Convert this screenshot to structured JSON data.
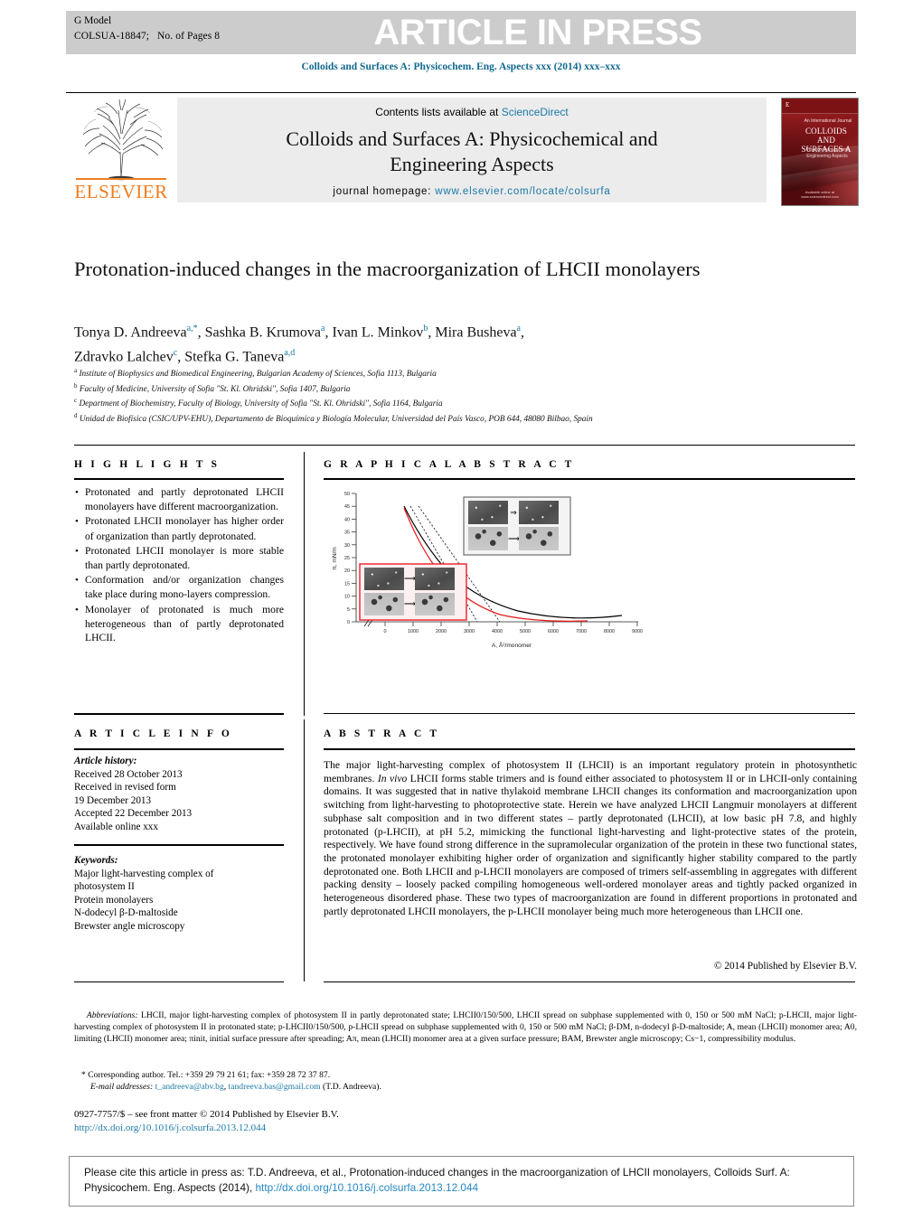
{
  "header": {
    "g_model": "G Model",
    "article_id": "COLSUA-18847;",
    "pages": "No. of Pages 8",
    "in_press": "ARTICLE IN PRESS",
    "journal_ref": "Colloids and Surfaces A: Physicochem. Eng. Aspects xxx (2014) xxx–xxx"
  },
  "masthead": {
    "contents_prefix": "Contents lists available at ",
    "sciencedirect": "ScienceDirect",
    "journal_title_line1": "Colloids and Surfaces A: Physicochemical and",
    "journal_title_line2": "Engineering Aspects",
    "homepage_label": "journal homepage: ",
    "homepage_url": "www.elsevier.com/locate/colsurfa",
    "publisher": "ELSEVIER"
  },
  "cover": {
    "top_small": "An International Journal",
    "title": "COLLOIDS AND SURFACES A",
    "subtitle": "Physicochemical and Engineering Aspects",
    "footer": "Available online at www.sciencedirect.com",
    "elsevier_mark": "E"
  },
  "article": {
    "title": "Protonation-induced changes in the macroorganization of LHCII monolayers",
    "authors_line1": "Tonya D. Andreeva",
    "authors_line1_sup": "a,*",
    "authors": [
      {
        "name": "Tonya D. Andreeva",
        "sup": "a,*"
      },
      {
        "name": "Sashka B. Krumova",
        "sup": "a"
      },
      {
        "name": "Ivan L. Minkov",
        "sup": "b"
      },
      {
        "name": "Mira Busheva",
        "sup": "a"
      },
      {
        "name": "Zdravko Lalchev",
        "sup": "c"
      },
      {
        "name": "Stefka G. Taneva",
        "sup": "a,d"
      }
    ],
    "affiliations": [
      {
        "mark": "a",
        "text": "Institute of Biophysics and Biomedical Engineering, Bulgarian Academy of Sciences, Sofia 1113, Bulgaria"
      },
      {
        "mark": "b",
        "text": "Faculty of Medicine, University of Sofia \"St. Kl. Ohridski\", Sofia 1407, Bulgaria"
      },
      {
        "mark": "c",
        "text": "Department of Biochemistry, Faculty of Biology, University of Sofia \"St. Kl. Ohridski\", Sofia 1164, Bulgaria"
      },
      {
        "mark": "d",
        "text": "Unidad de Biofísica (CSIC/UPV-EHU), Departamento de Bioquímica y Biología Molecular, Universidad del País Vasco, POB 644, 48080 Bilbao, Spain"
      }
    ]
  },
  "highlights": {
    "heading": "H I G H L I G H T S",
    "items": [
      "Protonated and partly deprotonated LHCII monolayers have different macroorganization.",
      "Protonated LHCII monolayer has higher order of organization than partly deprotonated.",
      "Protonated LHCII monolayer is more stable than partly deprotonated.",
      "Conformation and/or organization changes take place during mono-layers compression.",
      "Monolayer of protonated is much more heterogeneous than of partly deprotonated LHCII."
    ]
  },
  "graphical_abstract": {
    "heading": "G R A P H I C A L   A B S T R A C T"
  },
  "chart_data": {
    "type": "line",
    "title": "",
    "xlabel": "A, Å²/monomer",
    "ylabel": "π, mN/m",
    "xlim": [
      0,
      9000
    ],
    "ylim": [
      0,
      50
    ],
    "xticks": [
      0,
      1000,
      2000,
      3000,
      4000,
      5000,
      6000,
      7000,
      8000,
      9000
    ],
    "yticks": [
      0,
      5,
      10,
      15,
      20,
      25,
      30,
      35,
      40,
      45,
      50
    ],
    "grid": false,
    "legend": "none",
    "axis_break_x": true,
    "series": [
      {
        "name": "p-LHCII (black isotherm)",
        "color": "#000000",
        "style": "solid",
        "x": [
          700,
          900,
          1200,
          1600,
          2000,
          2600,
          3200,
          4000,
          4800,
          5600,
          6400,
          7200,
          8000,
          8400
        ],
        "y": [
          45.0,
          40.5,
          34.0,
          27.0,
          22.5,
          17.5,
          14.0,
          10.2,
          7.4,
          5.4,
          4.0,
          3.2,
          2.6,
          2.3
        ]
      },
      {
        "name": "LHCII (red isotherm)",
        "color": "#e8191b",
        "style": "solid",
        "x": [
          700,
          900,
          1200,
          1600,
          2000,
          2600,
          3200,
          4000,
          4800,
          5600,
          6400,
          7200,
          7900
        ],
        "y": [
          44.5,
          39.0,
          31.5,
          23.5,
          18.0,
          12.5,
          8.8,
          5.3,
          3.1,
          1.9,
          1.2,
          0.8,
          0.5
        ]
      },
      {
        "name": "extrapolation line 1 (dashed black)",
        "color": "#000000",
        "style": "dashed",
        "x": [
          900,
          3300
        ],
        "y": [
          45.0,
          0.0
        ]
      },
      {
        "name": "extrapolation line 2 (dashed black)",
        "color": "#000000",
        "style": "dashed",
        "x": [
          1200,
          4100
        ],
        "y": [
          45.0,
          0.0
        ]
      }
    ],
    "insets": [
      {
        "name": "p-LHCII inset (grey border)",
        "border_color": "#6f6f6f",
        "panels": [
          "BAM image",
          "arrow",
          "BAM image",
          "AFM image",
          "arrow",
          "AFM image"
        ]
      },
      {
        "name": "LHCII inset (red border)",
        "border_color": "#ee1c25",
        "panels": [
          "BAM image",
          "arrow",
          "BAM image",
          "AFM image",
          "arrow",
          "AFM image"
        ]
      }
    ]
  },
  "article_info": {
    "heading": "A R T I C L E   I N F O",
    "history_label": "Article history:",
    "history": [
      "Received 28 October 2013",
      "Received in revised form",
      "19 December 2013",
      "Accepted 22 December 2013",
      "Available online xxx"
    ],
    "keywords_label": "Keywords:",
    "keywords": [
      "Major light-harvesting complex of",
      "photosystem II",
      "Protein monolayers",
      "N-dodecyl β-D-maltoside",
      "Brewster angle microscopy"
    ]
  },
  "abstract": {
    "heading": "A B S T R A C T",
    "body_part1": "The major light-harvesting complex of photosystem II (LHCII) is an important regulatory protein in photosynthetic membranes. ",
    "body_italic1": "In vivo",
    "body_part2": " LHCII forms stable trimers and is found either associated to photosystem II or in LHCII-only containing domains. It was suggested that in native thylakoid membrane LHCII changes its conformation and macroorganization upon switching from light-harvesting to photoprotective state. Herein we have analyzed LHCII Langmuir monolayers at different subphase salt composition and in two different states – partly deprotonated (LHCII), at low basic pH 7.8, and highly protonated (p-LHCII), at pH 5.2, mimicking the functional light-harvesting and light-protective states of the protein, respectively. We have found strong difference in the supramolecular organization of the protein in these two functional states, the protonated monolayer exhibiting higher order of organization and significantly higher stability compared to the partly deprotonated one. Both LHCII and p-LHCII monolayers are composed of trimers self-assembling in aggregates with different packing density – loosely packed compiling homogeneous well-ordered monolayer areas and tightly packed organized in heterogeneous disordered phase. These two types of macroorganization are found in different proportions in protonated and partly deprotonated LHCII monolayers, the p-LHCII monolayer being much more heterogeneous than LHCII one.",
    "copyright": "© 2014 Published by Elsevier B.V."
  },
  "footnotes": {
    "abbrev_label": "Abbreviations:",
    "abbrev_text": " LHCII, major light-harvesting complex of photosystem II in partly deprotonated state; LHCII0/150/500, LHCII spread on subphase supplemented with 0, 150 or 500 mM NaCl; p-LHCII, major light-harvesting complex of photosystem II in protonated state; p-LHCII0/150/500, p-LHCII spread on subphase supplemented with 0, 150 or 500 mM NaCl; β-DM, n-dodecyl β-D-maltoside; A, mean (LHCII) monomer area; A0, limiting (LHCII) monomer area; πinit, initial surface pressure after spreading; Aπ, mean (LHCII) monomer area at a given surface pressure; BAM, Brewster angle microscopy; Cs−1, compressibility modulus.",
    "corresponding": "* Corresponding author. Tel.: +359 29 79 21 61; fax: +359 28 72 37 87.",
    "email_label": "E-mail addresses:",
    "email1": "t_andreeva@abv.bg",
    "email2": "tandreeva.bas@gmail.com",
    "email_suffix": " (T.D. Andreeva).",
    "frontmatter": "0927-7757/$ – see front matter © 2014 Published by Elsevier B.V.",
    "doi_url": "http://dx.doi.org/10.1016/j.colsurfa.2013.12.044"
  },
  "cite_box": {
    "line1": "Please cite this article in press as: T.D. Andreeva, et al., Protonation-induced changes in the macroorganization of LHCII monolayers, Colloids",
    "line2_prefix": "Surf. A: Physicochem. Eng. Aspects (2014), ",
    "line2_doi": "http://dx.doi.org/10.1016/j.colsurfa.2013.12.044"
  }
}
